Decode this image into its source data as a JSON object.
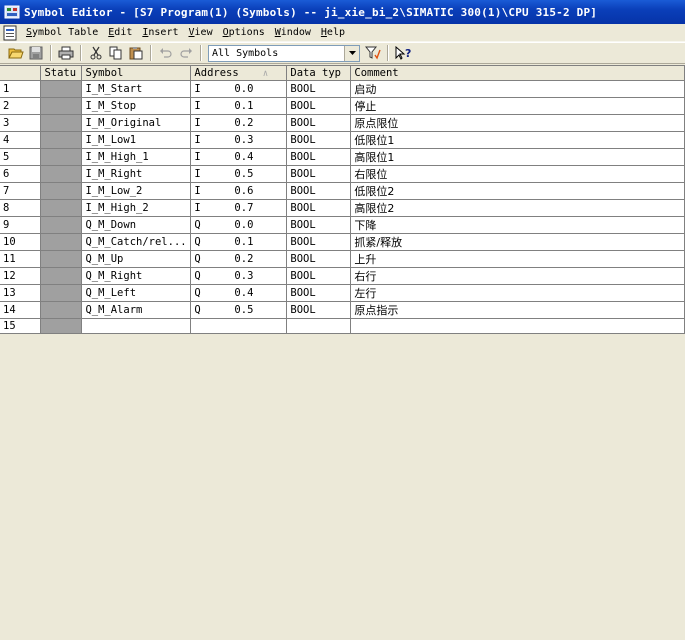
{
  "window": {
    "title": "Symbol Editor - [S7 Program(1) (Symbols) -- ji_xie_bi_2\\SIMATIC 300(1)\\CPU 315-2 DP]"
  },
  "menu": [
    {
      "label": "Symbol Table",
      "key": "S"
    },
    {
      "label": "Edit",
      "key": "E"
    },
    {
      "label": "Insert",
      "key": "I"
    },
    {
      "label": "View",
      "key": "V"
    },
    {
      "label": "Options",
      "key": "O"
    },
    {
      "label": "Window",
      "key": "W"
    },
    {
      "label": "Help",
      "key": "H"
    }
  ],
  "toolbar": {
    "filter_value": "All Symbols",
    "icons": [
      "open-icon",
      "save-icon",
      "print-icon",
      "cut-icon",
      "copy-icon",
      "paste-icon",
      "undo-icon",
      "redo-icon",
      "filter-icon",
      "help-icon"
    ]
  },
  "table": {
    "columns": [
      "",
      "Statu",
      "Symbol",
      "Address",
      "Data typ",
      "Comment"
    ],
    "sorted_column": "Address",
    "rows": [
      {
        "n": "1",
        "symbol": "I_M_Start",
        "area": "I",
        "addr": "0.0",
        "type": "BOOL",
        "comment": "启动"
      },
      {
        "n": "2",
        "symbol": "I_M_Stop",
        "area": "I",
        "addr": "0.1",
        "type": "BOOL",
        "comment": "停止"
      },
      {
        "n": "3",
        "symbol": "I_M_Original",
        "area": "I",
        "addr": "0.2",
        "type": "BOOL",
        "comment": "原点限位"
      },
      {
        "n": "4",
        "symbol": "I_M_Low1",
        "area": "I",
        "addr": "0.3",
        "type": "BOOL",
        "comment": "低限位1"
      },
      {
        "n": "5",
        "symbol": "I_M_High_1",
        "area": "I",
        "addr": "0.4",
        "type": "BOOL",
        "comment": "高限位1"
      },
      {
        "n": "6",
        "symbol": "I_M_Right",
        "area": "I",
        "addr": "0.5",
        "type": "BOOL",
        "comment": "右限位"
      },
      {
        "n": "7",
        "symbol": "I_M_Low_2",
        "area": "I",
        "addr": "0.6",
        "type": "BOOL",
        "comment": "低限位2"
      },
      {
        "n": "8",
        "symbol": "I_M_High_2",
        "area": "I",
        "addr": "0.7",
        "type": "BOOL",
        "comment": "高限位2"
      },
      {
        "n": "9",
        "symbol": "Q_M_Down",
        "area": "Q",
        "addr": "0.0",
        "type": "BOOL",
        "comment": "下降"
      },
      {
        "n": "10",
        "symbol": "Q_M_Catch/rel...",
        "area": "Q",
        "addr": "0.1",
        "type": "BOOL",
        "comment": "抓紧/释放"
      },
      {
        "n": "11",
        "symbol": "Q_M_Up",
        "area": "Q",
        "addr": "0.2",
        "type": "BOOL",
        "comment": "上升"
      },
      {
        "n": "12",
        "symbol": "Q_M_Right",
        "area": "Q",
        "addr": "0.3",
        "type": "BOOL",
        "comment": "右行"
      },
      {
        "n": "13",
        "symbol": "Q_M_Left",
        "area": "Q",
        "addr": "0.4",
        "type": "BOOL",
        "comment": "左行"
      },
      {
        "n": "14",
        "symbol": "Q_M_Alarm",
        "area": "Q",
        "addr": "0.5",
        "type": "BOOL",
        "comment": "原点指示"
      },
      {
        "n": "15",
        "symbol": "",
        "area": "",
        "addr": "",
        "type": "",
        "comment": ""
      }
    ]
  }
}
